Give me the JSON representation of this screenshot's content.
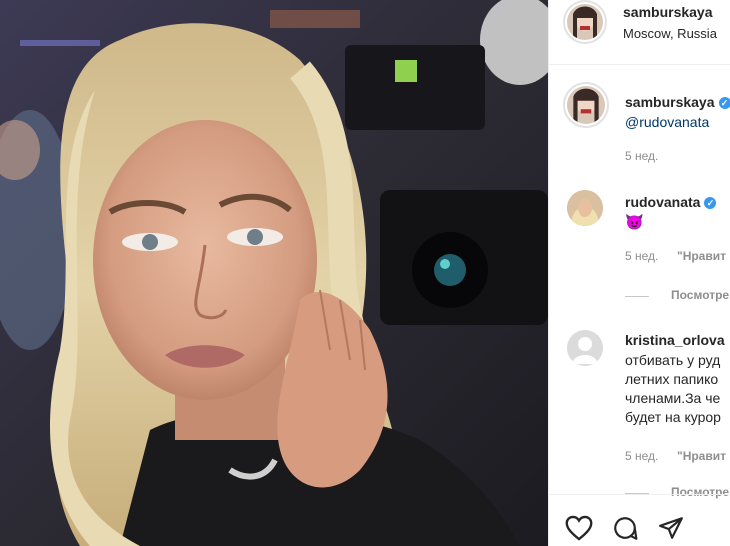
{
  "post": {
    "author": {
      "username": "samburskaya",
      "location": "Moscow, Russia",
      "avatar": "profile-photo"
    },
    "image": {
      "description_icon": "selfie-photo"
    }
  },
  "caption": {
    "username": "samburskaya",
    "mention": "@rudovanata",
    "age": "5 нед."
  },
  "comments": [
    {
      "username": "rudovanata",
      "verified": true,
      "text": "😈",
      "age": "5 нед.",
      "likes": "\"Нравит",
      "view_replies": "Посмотре"
    },
    {
      "username": "kristina_orlova",
      "verified": false,
      "lines": [
        "отбивать у руд",
        "летних папико",
        "членами.За че",
        "будет на курор"
      ],
      "age": "5 нед.",
      "likes": "\"Нравит",
      "view_replies": "Посмотре"
    }
  ],
  "actions": {
    "like": "heart-icon",
    "comment": "comment-icon",
    "share": "share-icon"
  },
  "colors": {
    "link": "#00376b",
    "verified": "#3897f0",
    "muted": "#8e8e8e"
  }
}
